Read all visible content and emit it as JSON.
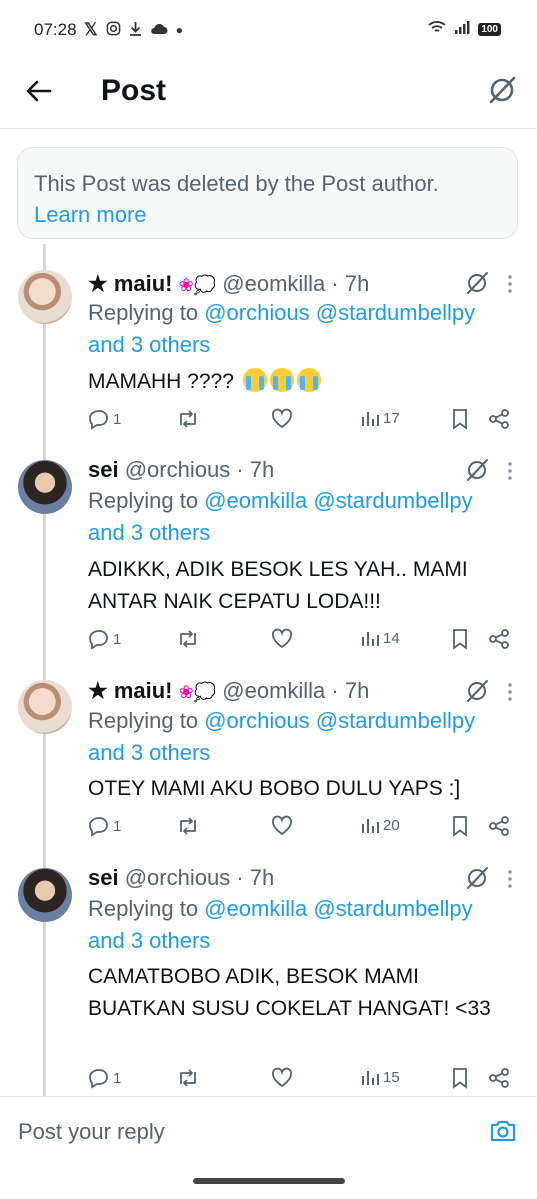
{
  "status_bar": {
    "time": "07:28",
    "icons": [
      "x-icon",
      "instagram-icon",
      "download-icon",
      "cloud-icon",
      "dot-icon"
    ],
    "battery": "100"
  },
  "header": {
    "title": "Post"
  },
  "notice": {
    "text": "This Post was deleted by the Post author.",
    "link": "Learn more"
  },
  "posts": [
    {
      "name": "★ maiu! ",
      "handle": "@eomkilla",
      "time": "· 7h",
      "replying_prefix": "Replying to ",
      "mentions": "@orchious @stardumbellpy",
      "others": "and 3 others",
      "text": "MAMAHH ???? ",
      "replies": "1",
      "views": "17",
      "avatar": "female"
    },
    {
      "name": "sei",
      "handle": "@orchious",
      "time": "· 7h",
      "replying_prefix": "Replying to ",
      "mentions": "@eomkilla @stardumbellpy",
      "others": "and 3 others",
      "text": "ADIKKK, ADIK BESOK LES YAH.. MAMI ANTAR NAIK CEPATU LODA!!!",
      "replies": "1",
      "views": "14",
      "avatar": "male"
    },
    {
      "name": "★ maiu! ",
      "handle": "@eomkilla",
      "time": "· 7h",
      "replying_prefix": "Replying to ",
      "mentions": "@orchious @stardumbellpy",
      "others": "and 3 others",
      "text": "OTEY MAMI AKU BOBO DULU YAPS :]",
      "replies": "1",
      "views": "20",
      "avatar": "female"
    },
    {
      "name": "sei",
      "handle": "@orchious",
      "time": "· 7h",
      "replying_prefix": "Replying to ",
      "mentions": "@eomkilla @stardumbellpy",
      "others": "and 3 others",
      "text": "CAMATBOBO ADIK, BESOK MAMI BUATKAN SUSU COKELAT HANGAT! <33",
      "replies": "1",
      "views": "15",
      "avatar": "male"
    }
  ],
  "composer": {
    "placeholder": "Post your reply"
  },
  "colors": {
    "accent": "#1d9bf0",
    "secondary_text": "#536471",
    "border": "#e6e9ec"
  }
}
